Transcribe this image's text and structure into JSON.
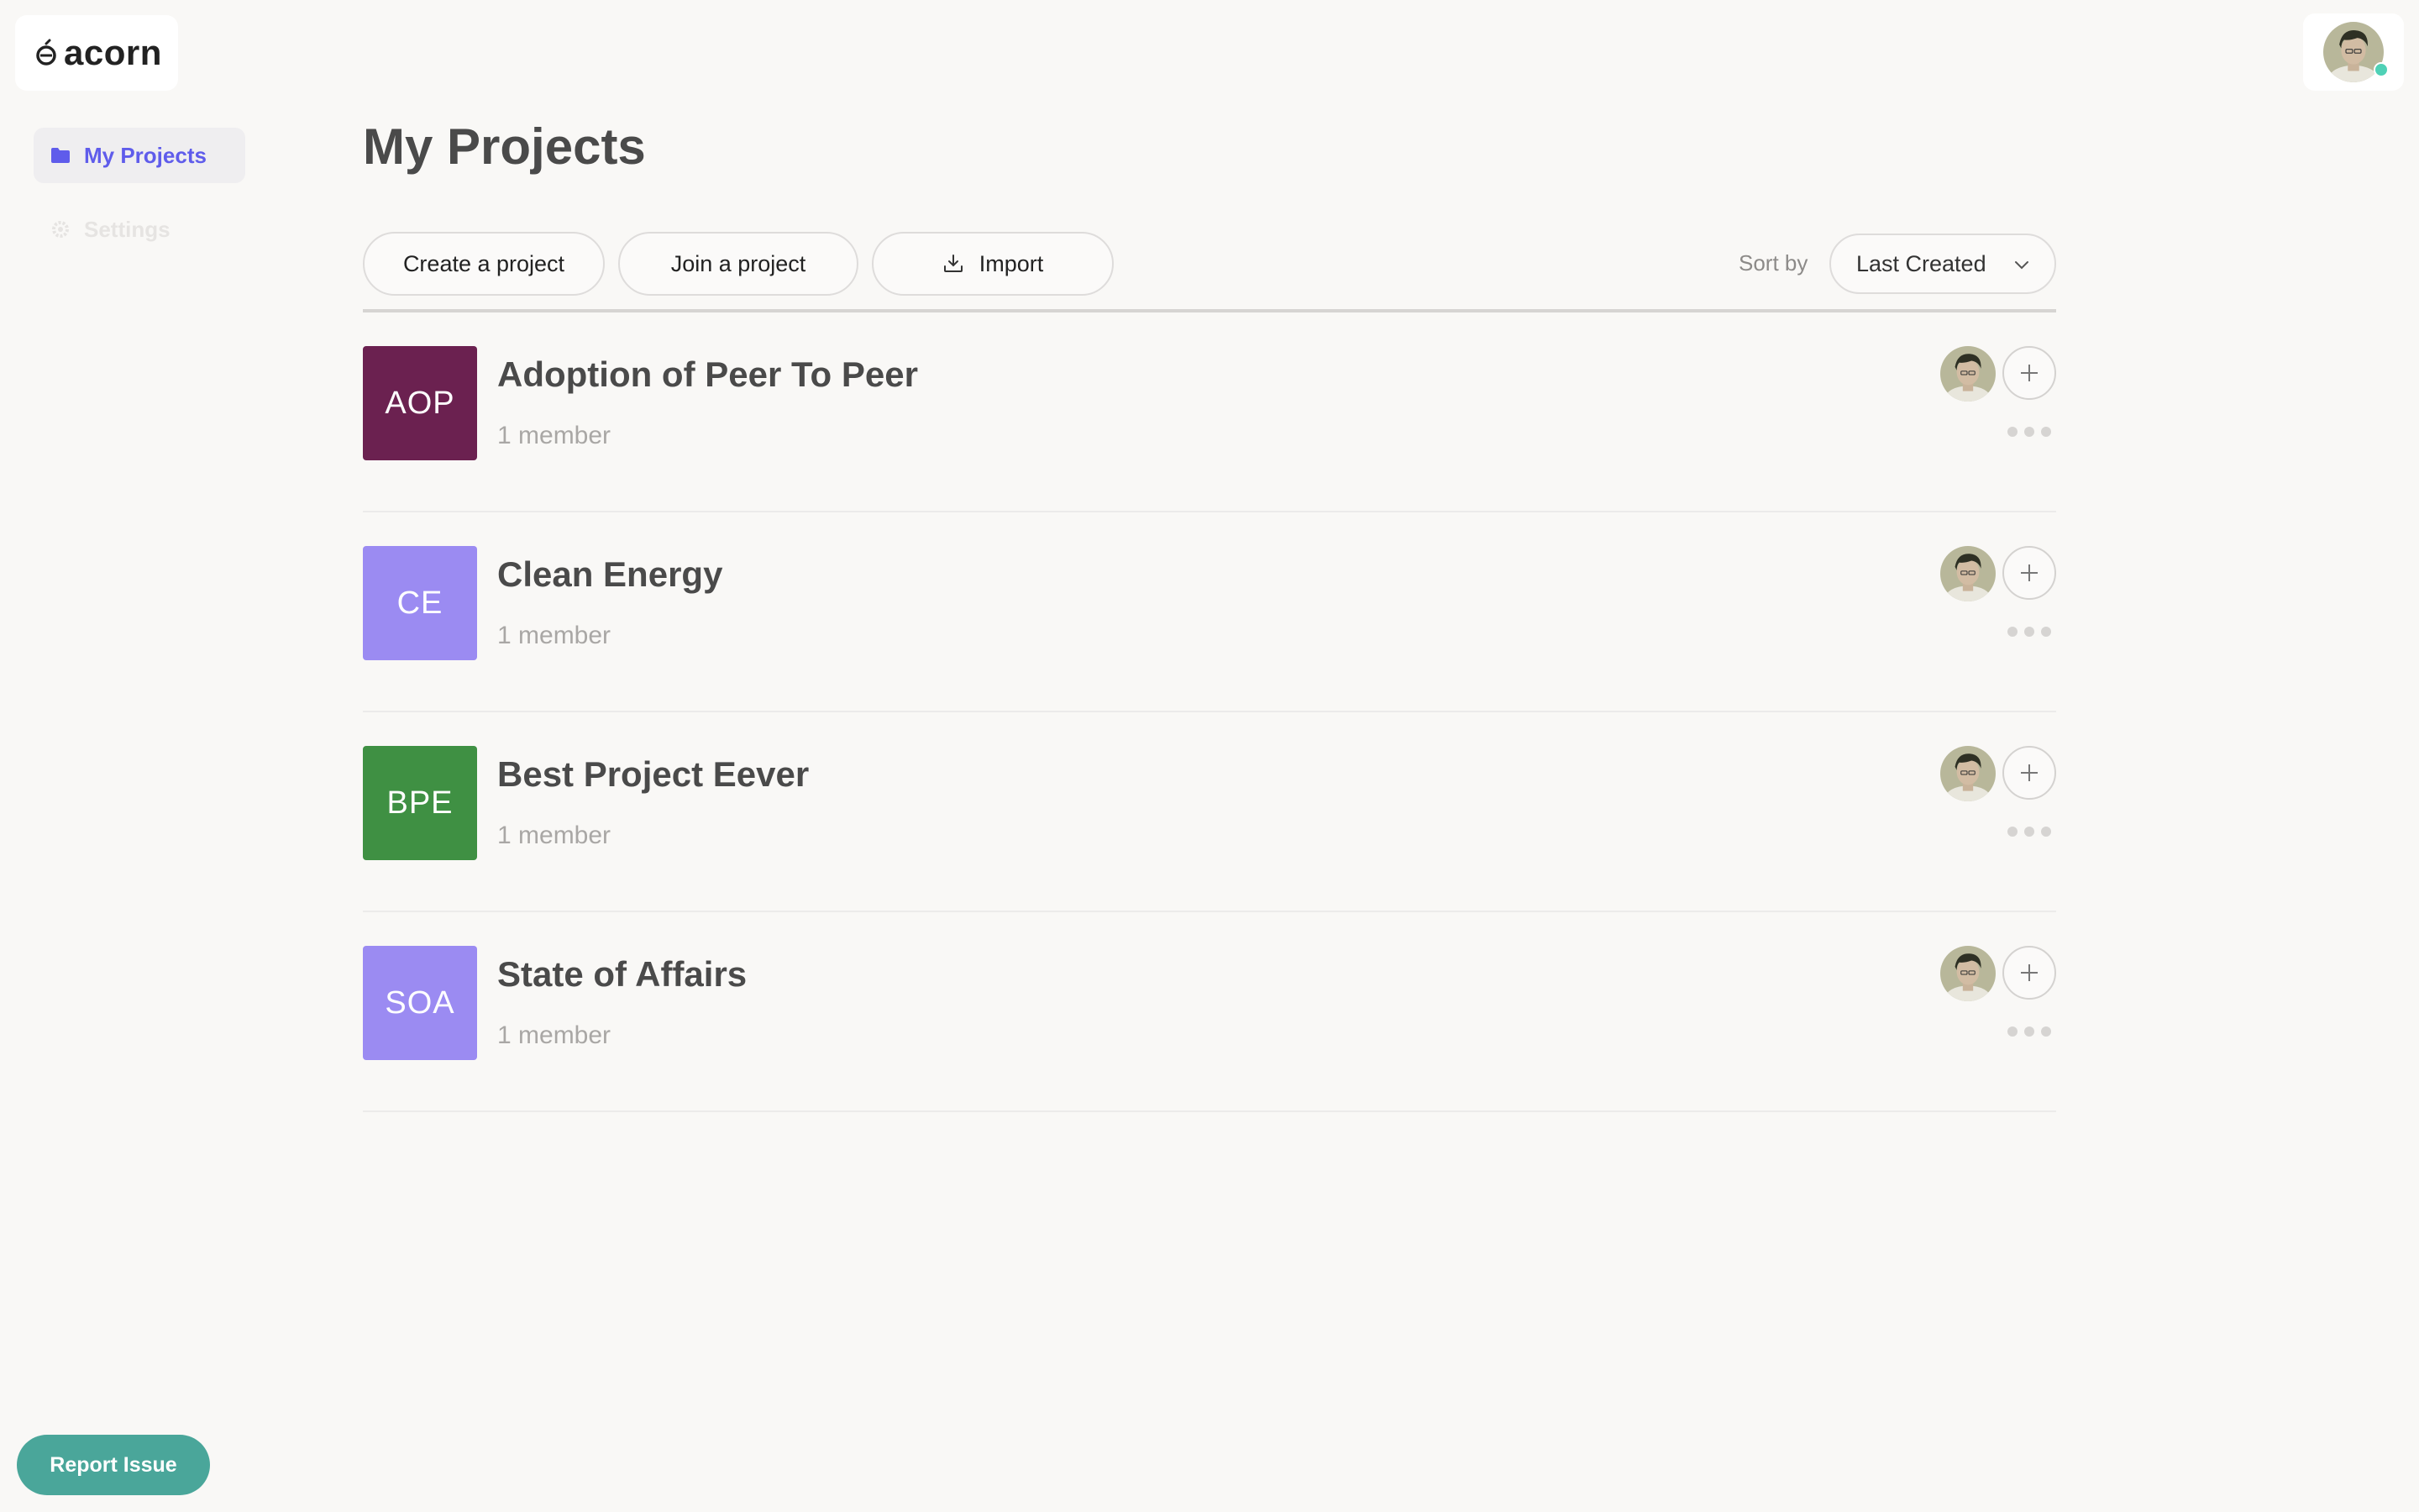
{
  "app": {
    "logo_text": "acorn"
  },
  "sidebar": {
    "items": [
      {
        "label": "My Projects",
        "icon": "folder-icon",
        "active": true
      },
      {
        "label": "Settings",
        "icon": "gear-icon",
        "active": false
      }
    ]
  },
  "header": {
    "title": "My Projects"
  },
  "toolbar": {
    "create_label": "Create a project",
    "join_label": "Join a project",
    "import_label": "Import",
    "sort_label": "Sort by",
    "sort_value": "Last Created"
  },
  "projects": [
    {
      "initials": "AOP",
      "name": "Adoption of Peer To Peer",
      "members": "1 member",
      "color": "#6b2150"
    },
    {
      "initials": "CE",
      "name": "Clean Energy",
      "members": "1 member",
      "color": "#9b8bf2"
    },
    {
      "initials": "BPE",
      "name": "Best Project Eever",
      "members": "1 member",
      "color": "#3f9043"
    },
    {
      "initials": "SOA",
      "name": "State of Affairs",
      "members": "1 member",
      "color": "#9b8bf2"
    }
  ],
  "footer": {
    "report_label": "Report Issue"
  },
  "colors": {
    "accent": "#5f5ceb",
    "report": "#4aa69a",
    "online": "#4fd1b6",
    "background": "#f9f8f6"
  }
}
